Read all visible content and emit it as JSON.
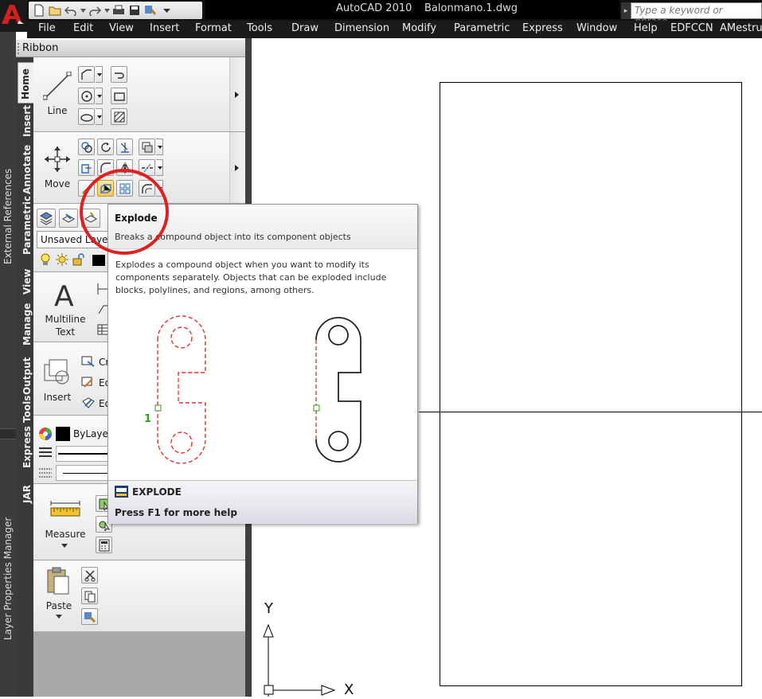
{
  "titlebar": {
    "app_name": "AutoCAD 2010",
    "file_name": "Balonmano.1.dwg",
    "search_placeholder": "Type a keyword or phrase"
  },
  "menu": [
    "File",
    "Edit",
    "View",
    "Insert",
    "Format",
    "Tools",
    "Draw",
    "Dimension",
    "Modify",
    "Parametric",
    "Express",
    "Window",
    "Help",
    "EDFCCN",
    "AMestruct"
  ],
  "left_strip": {
    "external_references": "External References",
    "layer_properties_manager": "Layer Properties Manager"
  },
  "ribbon": {
    "title": "Ribbon",
    "tabs": [
      "Home",
      "Insert",
      "Annotate",
      "Parametric",
      "View",
      "Manage",
      "Output",
      "Express Tools",
      "JAR"
    ],
    "line_label": "Line",
    "move_label": "Move",
    "layer_dropdown": "Unsaved Layer S",
    "multiline_label_1": "Multiline",
    "multiline_label_2": "Text",
    "insert_label": "Insert",
    "block_items": [
      "Cr",
      "Ed",
      "Ed"
    ],
    "bylayer": "ByLayer",
    "measure_label": "Measure",
    "paste_label": "Paste"
  },
  "tooltip": {
    "title": "Explode",
    "short_desc": "Breaks a compound object into its component objects",
    "long_desc": "Explodes a compound object when you want to modify its components separately. Objects that can be exploded include blocks, polylines, and regions, among others.",
    "selection_number": "1",
    "command": "EXPLODE",
    "help": "Press F1 for more help"
  },
  "ucs": {
    "y_label": "Y",
    "x_label": "X"
  },
  "colors": {
    "accent_red": "#e02020",
    "dashed_red": "#e53030",
    "titlebar": "#101010"
  }
}
